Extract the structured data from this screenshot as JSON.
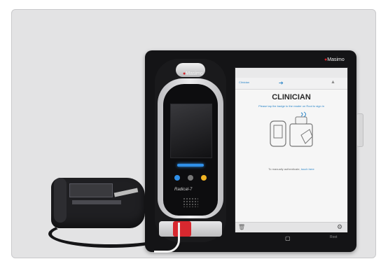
{
  "handheld": {
    "logo_text": "Masimo",
    "brand_text": "Radical-7"
  },
  "tablet": {
    "logo_text": "Masimo",
    "tab_clinician": "Clinician",
    "title": "CLINICIAN",
    "instruction": "Please tap the badge to the reader on Root to sign in",
    "manual_prefix": "To manually authenticate, ",
    "manual_link": "touch here",
    "home_text": "▢",
    "root_label": "Root"
  },
  "colors": {
    "frame_bg": "#e3e3e4",
    "connector_red": "#d7282f",
    "accent_blue": "#2a85c8"
  }
}
